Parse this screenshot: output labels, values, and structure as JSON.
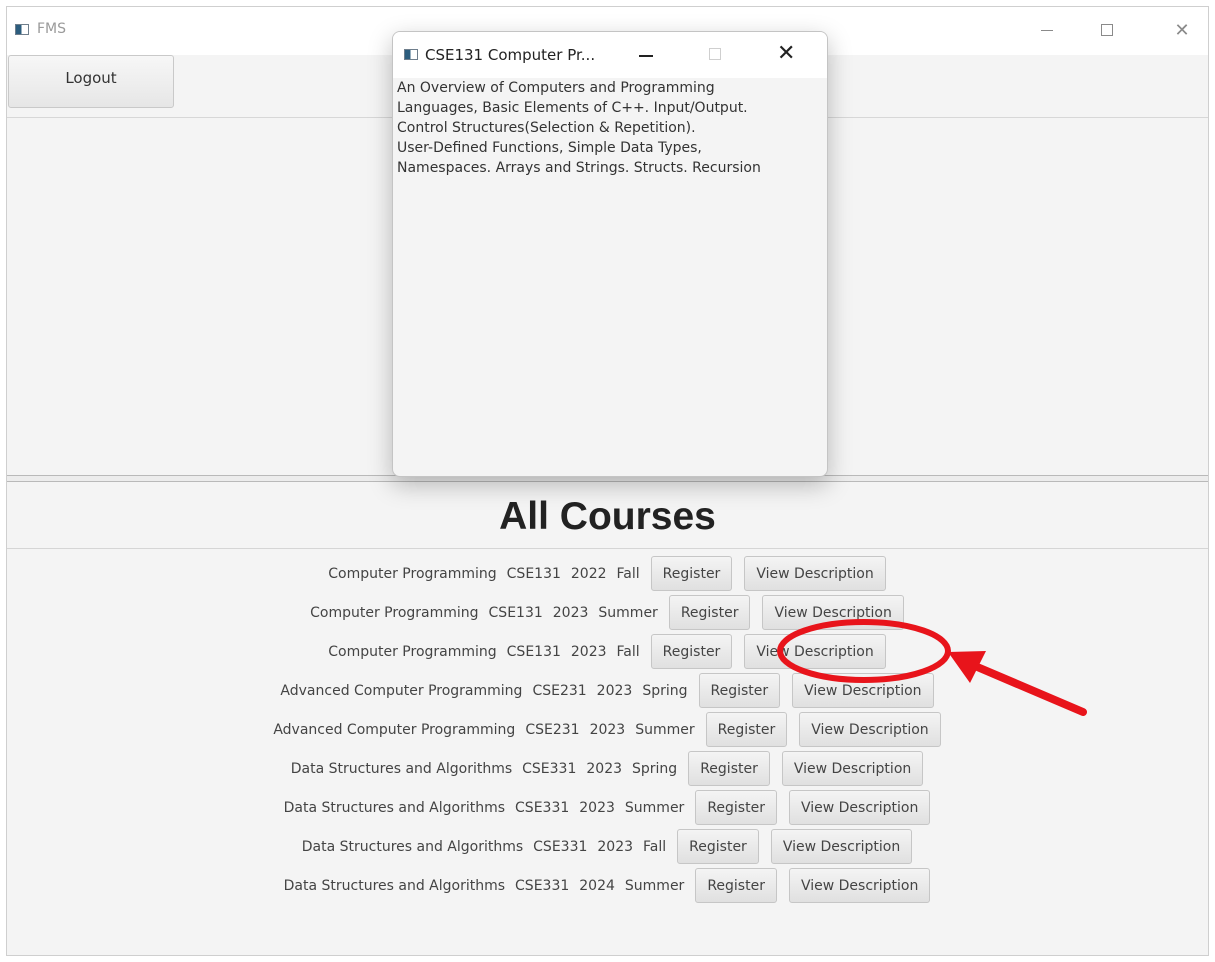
{
  "app": {
    "title": "FMS",
    "logout_label": "Logout"
  },
  "courses_section": {
    "title": "All Courses",
    "register_label": "Register",
    "view_label": "View Description",
    "rows": [
      {
        "name": "Computer Programming",
        "code": "CSE131",
        "year": "2022",
        "term": "Fall"
      },
      {
        "name": "Computer Programming",
        "code": "CSE131",
        "year": "2023",
        "term": "Summer"
      },
      {
        "name": "Computer Programming",
        "code": "CSE131",
        "year": "2023",
        "term": "Fall"
      },
      {
        "name": "Advanced Computer Programming",
        "code": "CSE231",
        "year": "2023",
        "term": "Spring"
      },
      {
        "name": "Advanced Computer Programming",
        "code": "CSE231",
        "year": "2023",
        "term": "Summer"
      },
      {
        "name": "Data Structures and Algorithms",
        "code": "CSE331",
        "year": "2023",
        "term": "Spring"
      },
      {
        "name": "Data Structures and Algorithms",
        "code": "CSE331",
        "year": "2023",
        "term": "Summer"
      },
      {
        "name": "Data Structures and Algorithms",
        "code": "CSE331",
        "year": "2023",
        "term": "Fall"
      },
      {
        "name": "Data Structures and Algorithms",
        "code": "CSE331",
        "year": "2024",
        "term": "Summer"
      }
    ]
  },
  "popup": {
    "title": "CSE131 Computer Pr...",
    "description_lines": [
      "An Overview of Computers and Programming",
      "Languages, Basic Elements of C++. Input/Output.",
      "Control Structures(Selection & Repetition).",
      "User-Defined Functions, Simple Data Types,",
      "Namespaces. Arrays and Strings. Structs. Recursion"
    ]
  },
  "colors": {
    "annotation": "#e8141b",
    "window_bg": "#f4f4f4"
  }
}
